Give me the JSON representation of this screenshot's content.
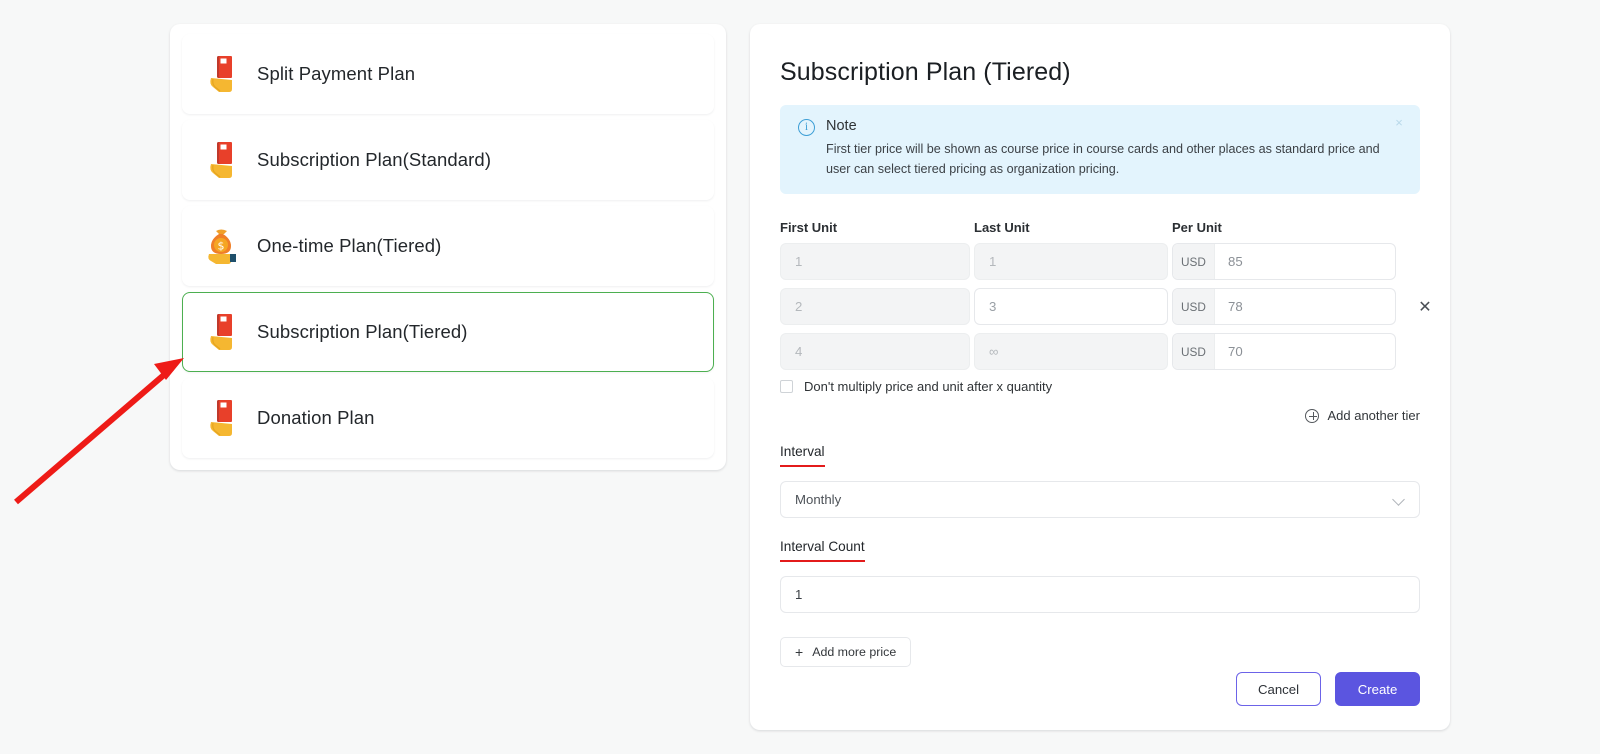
{
  "plan_list": {
    "items": [
      {
        "label": "Split Payment Plan",
        "icon": "card-in-hand-icon",
        "selected": false
      },
      {
        "label": "Subscription Plan(Standard)",
        "icon": "card-in-hand-icon",
        "selected": false
      },
      {
        "label": "One-time Plan(Tiered)",
        "icon": "money-bag-in-hand-icon",
        "selected": false
      },
      {
        "label": "Subscription Plan(Tiered)",
        "icon": "card-in-hand-icon",
        "selected": true
      },
      {
        "label": "Donation Plan",
        "icon": "card-in-hand-icon",
        "selected": false
      }
    ]
  },
  "form": {
    "title": "Subscription Plan (Tiered)",
    "note": {
      "title": "Note",
      "body": "First tier price will be shown as course price in course cards and other places as standard price and user can select tiered pricing as organization pricing.",
      "close_label": "×"
    },
    "tier_table": {
      "headers": {
        "first_unit": "First Unit",
        "last_unit": "Last Unit",
        "per_unit": "Per Unit"
      },
      "rows": [
        {
          "first_unit": "1",
          "last_unit": "1",
          "currency": "USD",
          "per_unit": "85",
          "remove_label": "",
          "first_disabled": true,
          "last_disabled": true
        },
        {
          "first_unit": "2",
          "last_unit": "3",
          "currency": "USD",
          "per_unit": "78",
          "remove_label": "✕",
          "first_disabled": true,
          "last_disabled": false
        },
        {
          "first_unit": "4",
          "last_unit": "∞",
          "currency": "USD",
          "per_unit": "70",
          "remove_label": "",
          "first_disabled": true,
          "last_disabled": true
        }
      ]
    },
    "multiply_checkbox": {
      "label": "Don't multiply price and unit after x quantity",
      "checked": false
    },
    "add_another_tier": {
      "label": "Add another tier",
      "icon": "circle-plus-icon"
    },
    "interval": {
      "label": "Interval",
      "value": "Monthly",
      "icon": "chevron-down-icon"
    },
    "interval_count": {
      "label": "Interval Count",
      "value": "1"
    },
    "add_more_price": {
      "label": "Add more price",
      "icon": "plus-icon"
    },
    "actions": {
      "cancel": "Cancel",
      "create": "Create"
    }
  },
  "annotations": {
    "arrow_color": "#ee1b17",
    "underline_color": "#e31b1b",
    "selected_border_color": "#4caf50",
    "primary_color": "#5b55e0",
    "note_bg_color": "#e3f4fd"
  }
}
